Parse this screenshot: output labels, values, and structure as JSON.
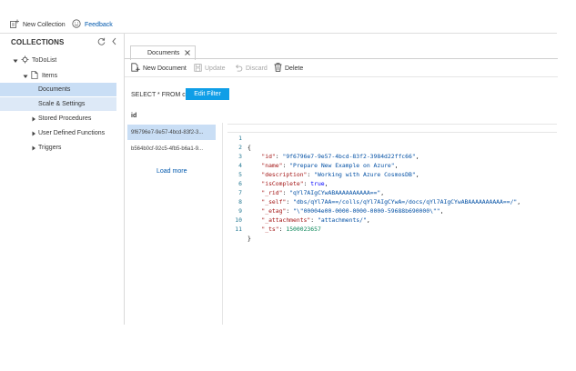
{
  "toolbar": {
    "new_collection": "New Collection",
    "feedback": "Feedback"
  },
  "sidebar": {
    "title": "COLLECTIONS",
    "database": "ToDoList",
    "collection": "Items",
    "items": [
      {
        "label": "Documents"
      },
      {
        "label": "Scale & Settings"
      },
      {
        "label": "Stored Procedures"
      },
      {
        "label": "User Defined Functions"
      },
      {
        "label": "Triggers"
      }
    ]
  },
  "tab": {
    "label": "Documents"
  },
  "commands": {
    "new_document": "New Document",
    "update": "Update",
    "discard": "Discard",
    "delete": "Delete"
  },
  "query": {
    "text": "SELECT * FROM c",
    "edit_filter": "Edit Filter"
  },
  "documents": {
    "column": "id",
    "rows": [
      {
        "id": "9f6796e7-9e57-4bcd-83f2-3..."
      },
      {
        "id": "b564b0cf-92c5-4fb5-b6a1-9..."
      }
    ],
    "load_more": "Load more"
  },
  "editor": {
    "line_numbers": [
      "1",
      "2",
      "3",
      "4",
      "5",
      "6",
      "7",
      "8",
      "9",
      "10",
      "11"
    ],
    "fields": {
      "id": {
        "key": "\"id\"",
        "value": "\"9f6796e7-9e57-4bcd-83f2-3984d22ffc66\""
      },
      "name": {
        "key": "\"name\"",
        "value": "\"Prepare New Example on Azure\""
      },
      "description": {
        "key": "\"description\"",
        "value": "\"Working with Azure CosmosDB\""
      },
      "isComplete": {
        "key": "\"isComplete\"",
        "value": "true"
      },
      "rid": {
        "key": "\"_rid\"",
        "value": "\"qYl7AIgCYwABAAAAAAAAAA==\""
      },
      "self": {
        "key": "\"_self\"",
        "value": "\"dbs/qYl7AA==/colls/qYl7AIgCYwA=/docs/qYl7AIgCYwABAAAAAAAAAA==/\""
      },
      "etag": {
        "key": "\"_etag\"",
        "value": "\"\\\"00004e00-0000-0000-0000-59688b690000\\\"\""
      },
      "attachments": {
        "key": "\"_attachments\"",
        "value": "\"attachments/\""
      },
      "ts": {
        "key": "\"_ts\"",
        "value": "1500023657"
      }
    },
    "open_brace": "{",
    "close_brace": "}"
  }
}
